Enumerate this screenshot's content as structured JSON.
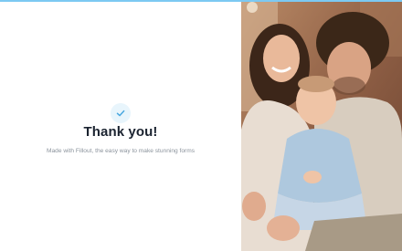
{
  "confirmation": {
    "title": "Thank you!",
    "subtitle": "Made with Fillout, the easy way to make stunning forms"
  },
  "colors": {
    "accent": "#7cc9f2",
    "check": "#4aa8e0",
    "title": "#1b2330",
    "subtitle": "#8b939c"
  },
  "icons": {
    "check": "check-icon"
  }
}
